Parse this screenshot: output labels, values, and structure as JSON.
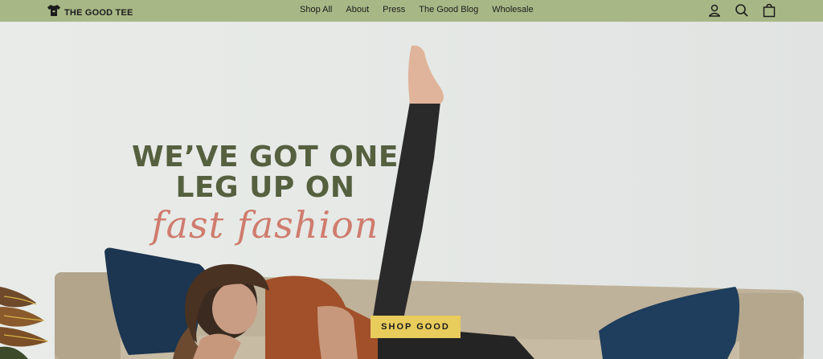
{
  "brand": {
    "name": "THE GOOD TEE",
    "logo_icon": "t-shirt-icon"
  },
  "nav": {
    "items": [
      {
        "label": "Shop All"
      },
      {
        "label": "About"
      },
      {
        "label": "Press"
      },
      {
        "label": "The Good Blog"
      },
      {
        "label": "Wholesale"
      }
    ],
    "icons": [
      "account-icon",
      "search-icon",
      "cart-icon"
    ]
  },
  "hero": {
    "headline_line1": "WE’VE GOT ONE",
    "headline_line2": "LEG UP ON",
    "script_text": "fast fashion",
    "cta_label": "SHOP GOOD"
  },
  "colors": {
    "header_bg": "#a7b886",
    "headline": "#55603f",
    "script": "#cf7c6e",
    "cta_bg": "#e8cc5c"
  }
}
